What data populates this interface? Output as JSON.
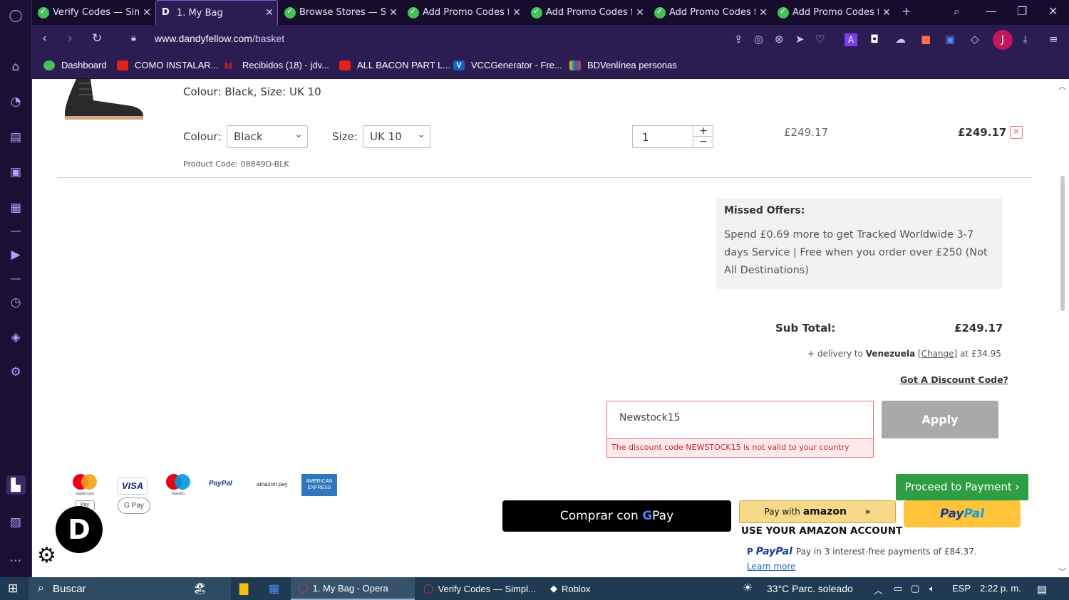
{
  "tabs": [
    {
      "title": "Verify Codes — Sim",
      "active": false
    },
    {
      "title": "1. My Bag",
      "active": true
    },
    {
      "title": "Browse Stores — Si",
      "active": false
    },
    {
      "title": "Add Promo Codes f",
      "active": false
    },
    {
      "title": "Add Promo Codes f",
      "active": false
    },
    {
      "title": "Add Promo Codes f",
      "active": false
    },
    {
      "title": "Add Promo Codes f",
      "active": false
    }
  ],
  "address": {
    "url_host": "www.dandyfellow.com",
    "url_path": "/basket"
  },
  "avatar_initial": "J",
  "bookmarks": [
    {
      "label": "Dashboard",
      "color": "#43c15b"
    },
    {
      "label": "COMO INSTALAR...",
      "color": "#e62117"
    },
    {
      "label": "Recibidos (18) - jdv...",
      "color": "#c5221f"
    },
    {
      "label": "ALL BACON PART L...",
      "color": "#e62117"
    },
    {
      "label": "VCCGenerator - Fre...",
      "color": "#1565c0"
    },
    {
      "label": "BDVenlínea personas",
      "color": "#f4c20d"
    }
  ],
  "product": {
    "variant_line": "Colour: Black, Size: UK 10",
    "colour_label": "Colour:",
    "colour_value": "Black",
    "size_label": "Size:",
    "size_value": "UK 10",
    "product_code": "Product Code: 08849D-BLK",
    "quantity": "1",
    "unit_price": "£249.17",
    "line_total": "£249.17"
  },
  "missed_offers": {
    "title": "Missed Offers:",
    "body": "Spend £0.69 more to get Tracked Worldwide 3-7 days Service | Free when you order over £250 (Not All Destinations)"
  },
  "summary": {
    "subtotal_label": "Sub Total:",
    "subtotal_value": "£249.17",
    "delivery_prefix": "+ delivery to",
    "delivery_country": "Venezuela",
    "delivery_change": "Change",
    "delivery_suffix": "at £34.95",
    "discount_link": "Got A Discount Code?"
  },
  "discount": {
    "code_value": "Newstock15",
    "error": "The discount code NEWSTOCK15 is not valid to your country",
    "apply_label": "Apply"
  },
  "checkout": {
    "proceed_label": "Proceed to Payment ›",
    "gpay_prefix": "Comprar con",
    "gpay_g": "G",
    "gpay_pay": "Pay",
    "amazon_prefix": "Pay with",
    "amazon_brand": "amazon",
    "amazon_sub": "USE YOUR AMAZON ACCOUNT",
    "paypal_pay": "Pay",
    "paypal_pal": "Pal",
    "paylater_brand": "PayPal",
    "paylater_text": "Pay in 3 interest-free payments of £84.37.",
    "learn_more": "Learn more"
  },
  "payment_logos": [
    "mastercard",
    "VISA",
    "maestro",
    "PayPal",
    "amazon pay",
    "AMERICAN EXPRESS",
    "Pay",
    "G Pay"
  ],
  "brand_logo_letter": "D",
  "taskbar": {
    "search": "Buscar",
    "apps": [
      "1. My Bag - Opera",
      "Verify Codes — Simpl...",
      "Roblox"
    ],
    "weather": "33°C  Parc. soleado",
    "lang": "ESP",
    "time": "2:22 p. m."
  }
}
